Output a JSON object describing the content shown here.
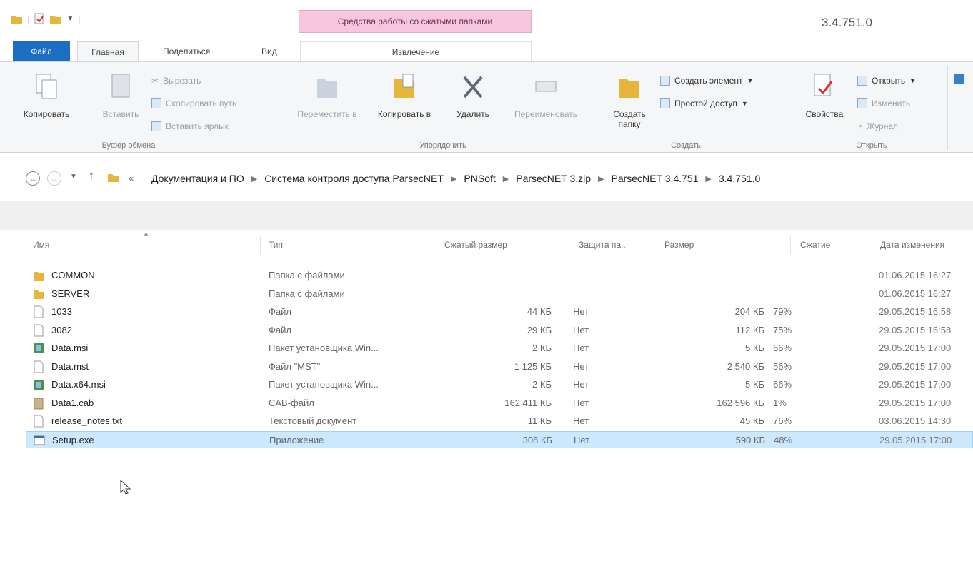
{
  "title_bar": {
    "context_tab_group": "Средства работы со сжатыми папками",
    "window_title": "3.4.751.0"
  },
  "tabs": {
    "file": "Файл",
    "home": "Главная",
    "share": "Поделиться",
    "view": "Вид",
    "extract": "Извлечение"
  },
  "ribbon": {
    "clipboard": {
      "copy": "Копировать",
      "paste": "Вставить",
      "cut": "Вырезать",
      "copy_path": "Скопировать путь",
      "paste_shortcut": "Вставить ярлык",
      "label": "Буфер обмена"
    },
    "organize": {
      "move_to": "Переместить в",
      "copy_to": "Копировать в",
      "delete": "Удалить",
      "rename": "Переименовать",
      "label": "Упорядочить"
    },
    "new": {
      "new_folder": "Создать папку",
      "new_item": "Создать элемент",
      "easy_access": "Простой доступ",
      "label": "Создать"
    },
    "open": {
      "properties": "Свойства",
      "open": "Открыть",
      "edit": "Изменить",
      "history": "Журнал",
      "label": "Открыть"
    }
  },
  "address": {
    "breadcrumbs": [
      "Документация и ПО",
      "Система контроля доступа ParsecNET",
      "PNSoft",
      "ParsecNET 3.zip",
      "ParsecNET 3.4.751",
      "3.4.751.0"
    ],
    "overflow": "«"
  },
  "columns": {
    "name": "Имя",
    "type": "Тип",
    "compressed_size": "Сжатый размер",
    "protected": "Защита па...",
    "size": "Размер",
    "ratio": "Сжатие",
    "date": "Дата изменения"
  },
  "files": [
    {
      "name": "COMMON",
      "type": "Папка с файлами",
      "csize": "",
      "prot": "",
      "size": "",
      "ratio": "",
      "date": "01.06.2015 16:27",
      "icon": "folder-icon"
    },
    {
      "name": "SERVER",
      "type": "Папка с файлами",
      "csize": "",
      "prot": "",
      "size": "",
      "ratio": "",
      "date": "01.06.2015 16:27",
      "icon": "folder-icon"
    },
    {
      "name": "1033",
      "type": "Файл",
      "csize": "44 КБ",
      "prot": "Нет",
      "size": "204 КБ",
      "ratio": "79%",
      "date": "29.05.2015 16:58",
      "icon": "file-icon"
    },
    {
      "name": "3082",
      "type": "Файл",
      "csize": "29 КБ",
      "prot": "Нет",
      "size": "112 КБ",
      "ratio": "75%",
      "date": "29.05.2015 16:58",
      "icon": "file-icon"
    },
    {
      "name": "Data.msi",
      "type": "Пакет установщика Win...",
      "csize": "2 КБ",
      "prot": "Нет",
      "size": "5 КБ",
      "ratio": "66%",
      "date": "29.05.2015 17:00",
      "icon": "msi-icon"
    },
    {
      "name": "Data.mst",
      "type": "Файл \"MST\"",
      "csize": "1 125 КБ",
      "prot": "Нет",
      "size": "2 540 КБ",
      "ratio": "56%",
      "date": "29.05.2015 17:00",
      "icon": "file-icon"
    },
    {
      "name": "Data.x64.msi",
      "type": "Пакет установщика Win...",
      "csize": "2 КБ",
      "prot": "Нет",
      "size": "5 КБ",
      "ratio": "66%",
      "date": "29.05.2015 17:00",
      "icon": "msi-icon"
    },
    {
      "name": "Data1.cab",
      "type": "CAB-файл",
      "csize": "162 411 КБ",
      "prot": "Нет",
      "size": "162 596 КБ",
      "ratio": "1%",
      "date": "29.05.2015 17:00",
      "icon": "cab-icon"
    },
    {
      "name": "release_notes.txt",
      "type": "Текстовый документ",
      "csize": "11 КБ",
      "prot": "Нет",
      "size": "45 КБ",
      "ratio": "76%",
      "date": "03.06.2015 14:30",
      "icon": "file-icon"
    },
    {
      "name": "Setup.exe",
      "type": "Приложение",
      "csize": "308 КБ",
      "prot": "Нет",
      "size": "590 КБ",
      "ratio": "48%",
      "date": "29.05.2015 17:00",
      "icon": "exe-icon",
      "selected": true
    }
  ],
  "colors": {
    "file_tab": "#1b6ec2",
    "context_band": "#f6c6dc",
    "selection": "#cce8ff",
    "folder": "#e8b53c"
  }
}
